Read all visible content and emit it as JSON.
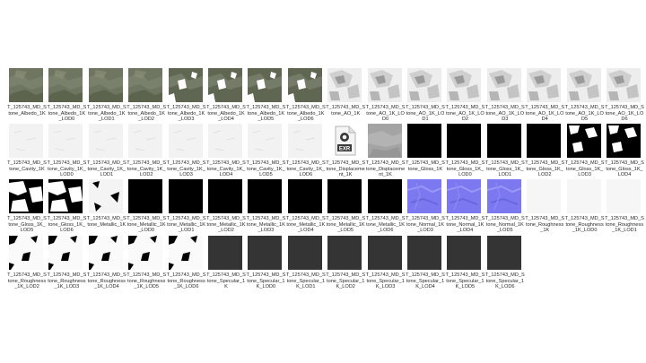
{
  "files": [
    {
      "name": "T_125743_MD_Stone_Albedo_1K",
      "kind": "albedo"
    },
    {
      "name": "T_125743_MD_Stone_Albedo_1K_LOD0",
      "kind": "albedo"
    },
    {
      "name": "T_125743_MD_Stone_Albedo_1K_LOD1",
      "kind": "albedo"
    },
    {
      "name": "T_125743_MD_Stone_Albedo_1K_LOD2",
      "kind": "albedo"
    },
    {
      "name": "T_125743_MD_Stone_Albedo_1K_LOD3",
      "kind": "albedo-cut"
    },
    {
      "name": "T_125743_MD_Stone_Albedo_1K_LOD4",
      "kind": "albedo-cut"
    },
    {
      "name": "T_125743_MD_Stone_Albedo_1K_LOD5",
      "kind": "albedo-cut"
    },
    {
      "name": "T_125743_MD_Stone_Albedo_1K_LOD6",
      "kind": "albedo-cut"
    },
    {
      "name": "T_125743_MD_Stone_AO_1K",
      "kind": "ao"
    },
    {
      "name": "T_125743_MD_Stone_AO_1K_LOD0",
      "kind": "ao"
    },
    {
      "name": "T_125743_MD_Stone_AO_1K_LOD1",
      "kind": "ao"
    },
    {
      "name": "T_125743_MD_Stone_AO_1K_LOD2",
      "kind": "ao"
    },
    {
      "name": "T_125743_MD_Stone_AO_1K_LOD3",
      "kind": "ao"
    },
    {
      "name": "T_125743_MD_Stone_AO_1K_LOD4",
      "kind": "ao"
    },
    {
      "name": "T_125743_MD_Stone_AO_1K_LOD5",
      "kind": "ao"
    },
    {
      "name": "T_125743_MD_Stone_AO_1K_LOD6",
      "kind": "ao"
    },
    {
      "name": "T_125743_MD_Stone_Cavity_1K",
      "kind": "cavity"
    },
    {
      "name": "T_125743_MD_Stone_Cavity_1K_LOD0",
      "kind": "cavity"
    },
    {
      "name": "T_125743_MD_Stone_Cavity_1K_LOD1",
      "kind": "cavity"
    },
    {
      "name": "T_125743_MD_Stone_Cavity_1K_LOD2",
      "kind": "cavity"
    },
    {
      "name": "T_125743_MD_Stone_Cavity_1K_LOD3",
      "kind": "cavity"
    },
    {
      "name": "T_125743_MD_Stone_Cavity_1K_LOD4",
      "kind": "cavity"
    },
    {
      "name": "T_125743_MD_Stone_Cavity_1K_LOD5",
      "kind": "cavity"
    },
    {
      "name": "T_125743_MD_Stone_Cavity_1K_LOD6",
      "kind": "cavity"
    },
    {
      "name": "T_125743_MD_Stone_Displacement_1K",
      "kind": "exr",
      "badge": "EXR"
    },
    {
      "name": "T_125743_MD_Stone_Displacement_1K",
      "kind": "disp"
    },
    {
      "name": "T_125743_MD_Stone_Gloss_1K",
      "kind": "black"
    },
    {
      "name": "T_125743_MD_Stone_Gloss_1K_LOD0",
      "kind": "black"
    },
    {
      "name": "T_125743_MD_Stone_Gloss_1K_LOD1",
      "kind": "black"
    },
    {
      "name": "T_125743_MD_Stone_Gloss_1K_LOD2",
      "kind": "black"
    },
    {
      "name": "T_125743_MD_Stone_Gloss_1K_LOD3",
      "kind": "gloss-white"
    },
    {
      "name": "T_125743_MD_Stone_Gloss_1K_LOD4",
      "kind": "gloss-white"
    },
    {
      "name": "T_125743_MD_Stone_Gloss_1K_LOD5",
      "kind": "gloss-white2"
    },
    {
      "name": "T_125743_MD_Stone_Gloss_1K_LOD6",
      "kind": "gloss-white2"
    },
    {
      "name": "T_125743_MD_Stone_Metallic_1K",
      "kind": "metal-spots"
    },
    {
      "name": "T_125743_MD_Stone_Metallic_1K_LOD0",
      "kind": "black"
    },
    {
      "name": "T_125743_MD_Stone_Metallic_1K_LOD1",
      "kind": "black"
    },
    {
      "name": "T_125743_MD_Stone_Metallic_1K_LOD2",
      "kind": "black"
    },
    {
      "name": "T_125743_MD_Stone_Metallic_1K_LOD3",
      "kind": "black"
    },
    {
      "name": "T_125743_MD_Stone_Metallic_1K_LOD4",
      "kind": "black"
    },
    {
      "name": "T_125743_MD_Stone_Metallic_1K_LOD5",
      "kind": "black"
    },
    {
      "name": "T_125743_MD_Stone_Metallic_1K_LOD6",
      "kind": "black"
    },
    {
      "name": "T_125743_MD_Stone_Normal_1K_LOD3",
      "kind": "normal"
    },
    {
      "name": "T_125743_MD_Stone_Normal_1K_LOD4",
      "kind": "normal"
    },
    {
      "name": "T_125743_MD_Stone_Normal_1K_LOD5",
      "kind": "normal"
    },
    {
      "name": "T_125743_MD_Stone_Roughness_1K",
      "kind": "white"
    },
    {
      "name": "T_125743_MD_Stone_Roughness_1K_LOD0",
      "kind": "white"
    },
    {
      "name": "T_125743_MD_Stone_Roughness_1K_LOD1",
      "kind": "white"
    },
    {
      "name": "T_125743_MD_Stone_Roughness_1K_LOD2",
      "kind": "rough-white"
    },
    {
      "name": "T_125743_MD_Stone_Roughness_1K_LOD3",
      "kind": "rough-white"
    },
    {
      "name": "T_125743_MD_Stone_Roughness_1K_LOD4",
      "kind": "rough-white"
    },
    {
      "name": "T_125743_MD_Stone_Roughness_1K_LOD5",
      "kind": "rough-white"
    },
    {
      "name": "T_125743_MD_Stone_Roughness_1K_LOD6",
      "kind": "rough-white"
    },
    {
      "name": "T_125743_MD_Stone_Specular_1K",
      "kind": "spec"
    },
    {
      "name": "T_125743_MD_Stone_Specular_1K_LOD0",
      "kind": "spec"
    },
    {
      "name": "T_125743_MD_Stone_Specular_1K_LOD1",
      "kind": "spec"
    },
    {
      "name": "T_125743_MD_Stone_Specular_1K_LOD2",
      "kind": "spec"
    },
    {
      "name": "T_125743_MD_Stone_Specular_1K_LOD3",
      "kind": "spec"
    },
    {
      "name": "T_125743_MD_Stone_Specular_1K_LOD4",
      "kind": "spec"
    },
    {
      "name": "T_125743_MD_Stone_Specular_1K_LOD5",
      "kind": "spec"
    },
    {
      "name": "T_125743_MD_Stone_Specular_1K_LOD6",
      "kind": "spec"
    }
  ],
  "colors": {
    "albedo": "#6e7560",
    "ao": "#e8e8e8",
    "normal": "#7c79f0",
    "specular": "#343434"
  }
}
